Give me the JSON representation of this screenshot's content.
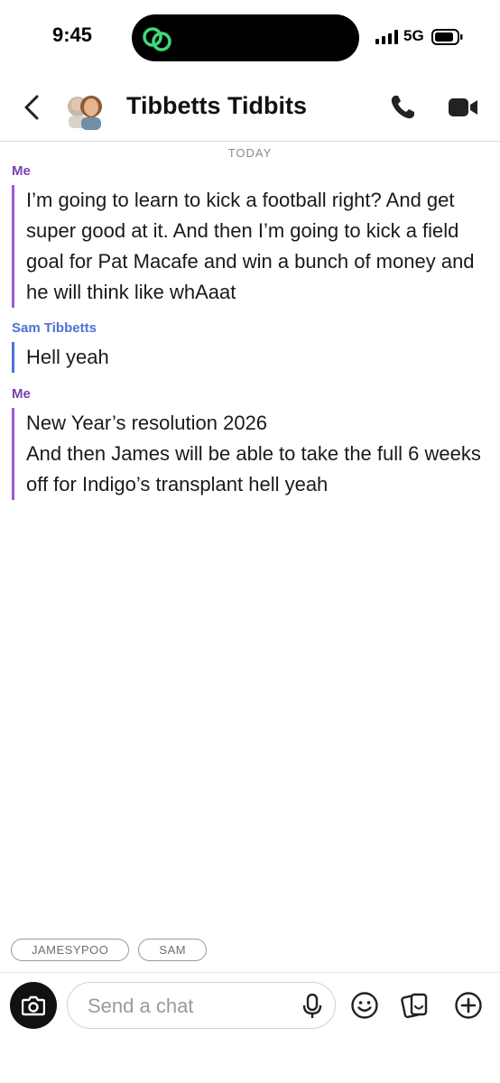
{
  "status_bar": {
    "time": "9:45",
    "network": "5G"
  },
  "header": {
    "title": "Tibbetts Tidbits"
  },
  "day_separator": "TODAY",
  "messages": [
    {
      "sender": "Me",
      "lines": [
        "I’m going to learn to kick a football right? And get super good at it. And then I’m going to kick a field goal for Pat Macafe and win a bunch of money and he will think like whAaat"
      ]
    },
    {
      "sender": "Sam Tibbetts",
      "lines": [
        "Hell yeah"
      ]
    },
    {
      "sender": "Me",
      "lines": [
        "New Year’s resolution 2026",
        "And then James will be able to take the full 6 weeks off for Indigo’s transplant hell yeah"
      ]
    }
  ],
  "chips": [
    "JAMESYPOO",
    "SAM"
  ],
  "composer": {
    "placeholder": "Send a chat"
  },
  "colors": {
    "me": "#7b3fb5",
    "sam": "#4a73d6",
    "accent_green": "#3fd97a"
  },
  "icons": [
    "back-chevron-icon",
    "phone-icon",
    "video-icon",
    "camera-icon",
    "mic-icon",
    "emoji-icon",
    "stickers-icon",
    "plus-icon"
  ]
}
